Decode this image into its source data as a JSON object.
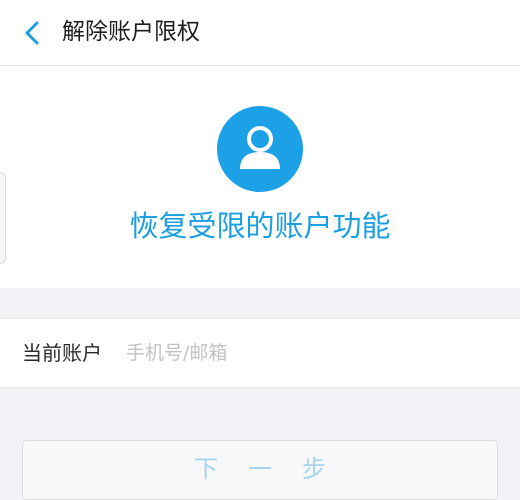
{
  "header": {
    "back_icon": "chevron-left-icon",
    "title": "解除账户限权"
  },
  "hero": {
    "icon": "user-avatar-icon",
    "message": "恢复受限的账户功能"
  },
  "form": {
    "account_label": "当前账户",
    "account_placeholder": "手机号/邮箱",
    "account_value": ""
  },
  "actions": {
    "next_label": "下一步"
  },
  "colors": {
    "accent": "#1a9fe0",
    "avatar_bg": "#1da1e6",
    "page_bg": "#f2f3f7",
    "header_bg": "#ffffff"
  }
}
